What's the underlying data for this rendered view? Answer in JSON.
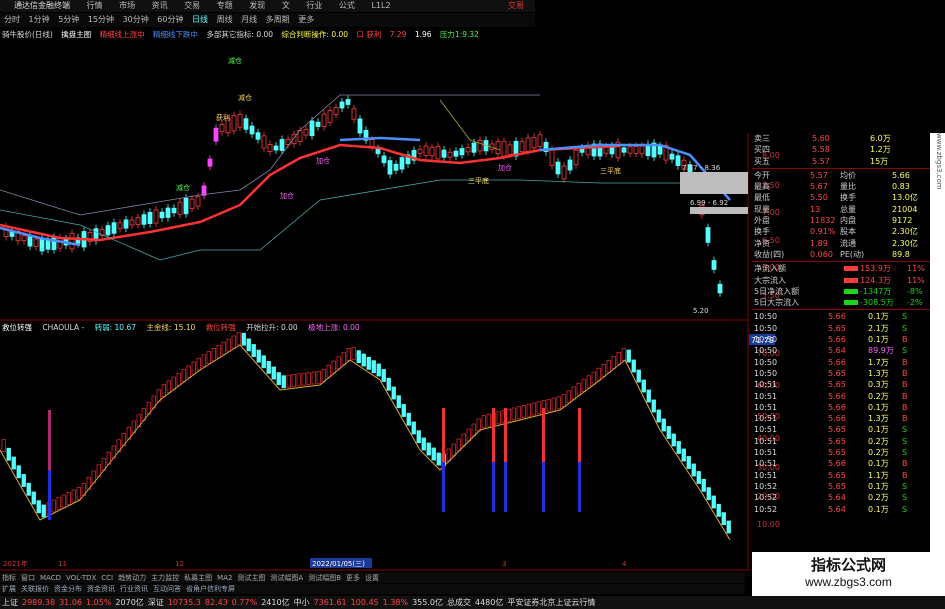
{
  "title_bar": {
    "app_title": "通达信金融终端",
    "menus": [
      "行情",
      "市场",
      "资讯",
      "交易",
      "专题",
      "发现",
      "文",
      "行业",
      "公式",
      "L1L2"
    ],
    "trade": "交易"
  },
  "toolbar": {
    "periods": [
      "分时",
      "1分钟",
      "5分钟",
      "15分钟",
      "30分钟",
      "60分钟",
      "日线",
      "周线",
      "月线",
      "多周期",
      "更多"
    ],
    "active_period": "日线"
  },
  "main_header": {
    "stock": "骑牛股价(日线)",
    "items": [
      {
        "text": "擒盘主图",
        "color": "#ffffff"
      },
      {
        "text": "精细线上涨中",
        "color": "#ff4444"
      },
      {
        "text": "精细线下跌中",
        "color": "#4a90ff"
      },
      {
        "text": "多部其它指标: 0.00",
        "color": "#dddddd"
      },
      {
        "text": "综合判断操作: 0.00",
        "color": "#ffff44"
      },
      {
        "text": "口 获利",
        "color": "#ff4444"
      },
      {
        "text": "7.29",
        "color": "#ff4444"
      },
      {
        "text": "1.96",
        "color": "#ffffff"
      },
      {
        "text": "压力1:9.32",
        "color": "#44ff44"
      }
    ]
  },
  "chart_labels": [
    {
      "text": "减仓",
      "color": "#55ff55"
    },
    {
      "text": "减仓",
      "color": "#ffdd55"
    },
    {
      "text": "获利",
      "color": "#ffdd55"
    },
    {
      "text": "减仓",
      "color": "#55ff55"
    },
    {
      "text": "加仓",
      "color": "#ff66ff"
    },
    {
      "text": "加仓",
      "color": "#ff66ff"
    },
    {
      "text": "三平底",
      "color": "#ffdd55"
    },
    {
      "text": "三平底",
      "color": "#ffdd55"
    },
    {
      "text": "加仓",
      "color": "#ff66ff"
    },
    {
      "text": "7.67 - 8.36",
      "color": "#dddddd"
    },
    {
      "text": "6.99 - 6.92",
      "color": "#dddddd"
    },
    {
      "text": "5.20",
      "color": "#dddddd"
    }
  ],
  "price_axis": [
    "8.00",
    "7.50",
    "7.00",
    "6.50",
    "6.00",
    "5.50"
  ],
  "sub_header": {
    "items": [
      {
        "text": "救位转强",
        "color": "#ffffff"
      },
      {
        "text": "CHAOULA -",
        "color": "#dddddd"
      },
      {
        "text": "转弱: 10.67",
        "color": "#55ffff"
      },
      {
        "text": "主金线: 15.10",
        "color": "#ffdd55"
      },
      {
        "text": "救位转强",
        "color": "#ff4444"
      },
      {
        "text": "开始拉升: 0.00",
        "color": "#dddddd"
      },
      {
        "text": "极地上涨: 0.00",
        "color": "#ff66ff"
      }
    ]
  },
  "sub_axis": [
    "71.79",
    "70.00",
    "60.00",
    "50.00",
    "40.00",
    "30.00",
    "20.00",
    "10.00"
  ],
  "date_axis": [
    "2021年",
    "11",
    "12",
    "2022/01/05(三)",
    "3",
    "4"
  ],
  "quote_panel": {
    "orderbook": [
      {
        "label": "卖三",
        "price": "5.60",
        "vol": "6.0万"
      },
      {
        "label": "买四",
        "price": "5.58",
        "vol": "1.2万"
      },
      {
        "label": "买五",
        "price": "5.57",
        "vol": "15万"
      }
    ],
    "stats": [
      {
        "l1": "今开",
        "v1": "5.57",
        "l2": "均价",
        "v2": "5.66"
      },
      {
        "l1": "最高",
        "v1": "5.67",
        "l2": "量比",
        "v2": "0.83"
      },
      {
        "l1": "最低",
        "v1": "5.50",
        "l2": "换手",
        "v2": "13.0亿"
      },
      {
        "l1": "现量",
        "v1": "13",
        "l2": "总量",
        "v2": "21004"
      },
      {
        "l1": "外盘",
        "v1": "11832",
        "l2": "内盘",
        "v2": "9172"
      },
      {
        "l1": "换手",
        "v1": "0.91%",
        "l2": "股本",
        "v2": "2.30亿"
      },
      {
        "l1": "净资",
        "v1": "1.89",
        "l2": "流通",
        "v2": "2.30亿"
      },
      {
        "l1": "收益(四)",
        "v1": "0.060",
        "l2": "PE(动)",
        "v2": "89.8"
      }
    ],
    "flows": [
      {
        "label": "净流入额",
        "value": "153.9万",
        "pct": "11%"
      },
      {
        "label": "大宗流入",
        "value": "124.3万",
        "pct": "11%"
      },
      {
        "label": "5日净流入额",
        "value": "-1347万",
        "pct": "-8%"
      },
      {
        "label": "5日大宗流入",
        "value": "-308.5万",
        "pct": "-2%"
      }
    ],
    "ticks": [
      {
        "t": "10:50",
        "p": "5.66",
        "v": "0.1万",
        "s": "S"
      },
      {
        "t": "10:50",
        "p": "5.65",
        "v": "2.1万",
        "s": "S"
      },
      {
        "t": "10:50",
        "p": "5.66",
        "v": "0.1万",
        "s": "B"
      },
      {
        "t": "10:50",
        "p": "5.64",
        "v": "89.9万",
        "s": "S"
      },
      {
        "t": "10:50",
        "p": "5.66",
        "v": "1.7万",
        "s": "B"
      },
      {
        "t": "10:50",
        "p": "5.65",
        "v": "1.3万",
        "s": "B"
      },
      {
        "t": "10:51",
        "p": "5.65",
        "v": "0.3万",
        "s": "B"
      },
      {
        "t": "10:51",
        "p": "5.66",
        "v": "0.2万",
        "s": "B"
      },
      {
        "t": "10:51",
        "p": "5.66",
        "v": "0.1万",
        "s": "B"
      },
      {
        "t": "10:51",
        "p": "5.66",
        "v": "1.3万",
        "s": "B"
      },
      {
        "t": "10:51",
        "p": "5.65",
        "v": "0.1万",
        "s": "S"
      },
      {
        "t": "10:51",
        "p": "5.65",
        "v": "0.2万",
        "s": "S"
      },
      {
        "t": "10:51",
        "p": "5.65",
        "v": "0.2万",
        "s": "S"
      },
      {
        "t": "10:51",
        "p": "5.66",
        "v": "0.1万",
        "s": "B"
      },
      {
        "t": "10:51",
        "p": "5.65",
        "v": "1.1万",
        "s": "B"
      },
      {
        "t": "10:52",
        "p": "5.65",
        "v": "0.1万",
        "s": "S"
      },
      {
        "t": "10:52",
        "p": "5.64",
        "v": "0.2万",
        "s": "S"
      },
      {
        "t": "10:52",
        "p": "5.64",
        "v": "0.1万",
        "s": "S"
      }
    ]
  },
  "bottom_tabs": [
    "指标",
    "窗口",
    "MACD",
    "VOL-TDX",
    "CCI",
    "趋势动力",
    "主力监控",
    "私募主图",
    "MA2",
    "测试主图",
    "测试幅图A",
    "测试幅图B",
    "更多",
    "设置"
  ],
  "bottom_tabs2": [
    "扩展",
    "关联报价",
    "资金分布",
    "资金资讯",
    "行业资讯",
    "互动问答",
    "省角户信利专屏"
  ],
  "ticker": [
    {
      "text": "上证",
      "color": "#dddddd"
    },
    {
      "text": "2989.38",
      "color": "#ff4444"
    },
    {
      "text": "31.06",
      "color": "#ff4444"
    },
    {
      "text": "1.05%",
      "color": "#ff4444"
    },
    {
      "text": "2070亿",
      "color": "#dddddd"
    },
    {
      "text": "深证",
      "color": "#dddddd"
    },
    {
      "text": "10735.3",
      "color": "#ff4444"
    },
    {
      "text": "82.43",
      "color": "#ff4444"
    },
    {
      "text": "0.77%",
      "color": "#ff4444"
    },
    {
      "text": "2410亿",
      "color": "#dddddd"
    },
    {
      "text": "中小",
      "color": "#dddddd"
    },
    {
      "text": "7361.61",
      "color": "#ff4444"
    },
    {
      "text": "100.45",
      "color": "#ff4444"
    },
    {
      "text": "1.38%",
      "color": "#ff4444"
    },
    {
      "text": "355.0亿",
      "color": "#dddddd"
    },
    {
      "text": "总成交",
      "color": "#dddddd"
    },
    {
      "text": "4480亿",
      "color": "#dddddd"
    },
    {
      "text": "平安证券北京上证云行情",
      "color": "#dddddd"
    }
  ],
  "watermark": {
    "title": "指标公式网",
    "url": "www.zbgs3.com",
    "side": "www.zbgs3.com"
  }
}
